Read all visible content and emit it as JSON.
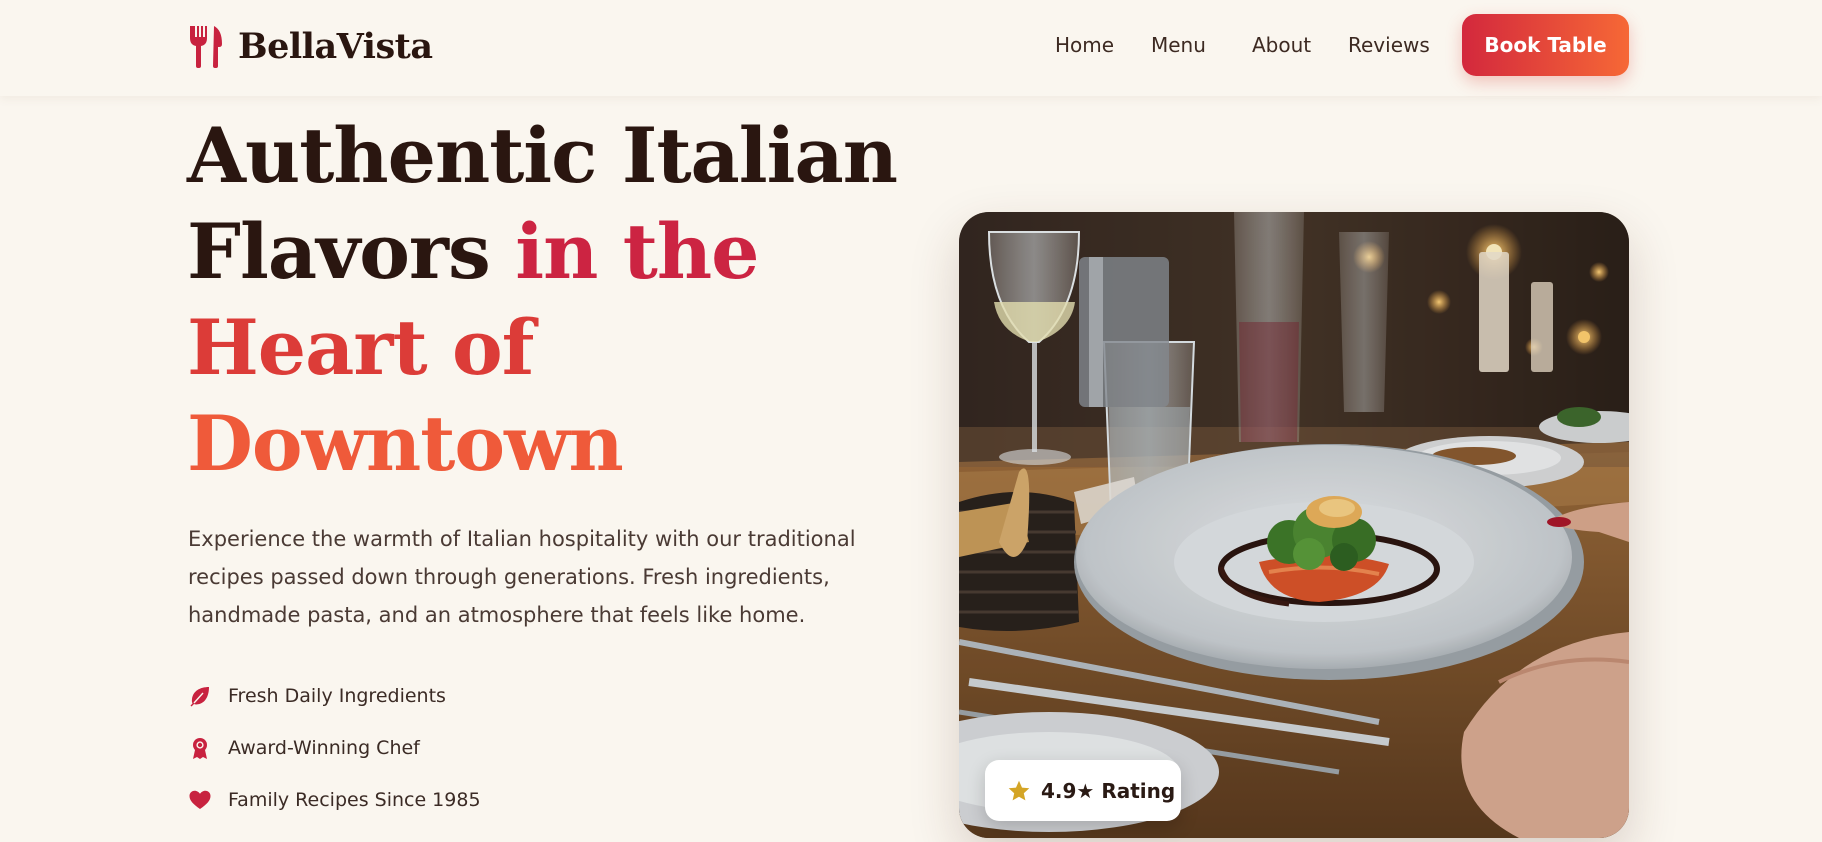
{
  "brand": {
    "name": "BellaVista",
    "icon": "fork-knife-icon",
    "color": "#c8223f"
  },
  "nav": {
    "links": [
      {
        "label": "Home"
      },
      {
        "label": "Menu"
      },
      {
        "label": "About"
      },
      {
        "label": "Reviews"
      }
    ],
    "cta_label": "Book Table"
  },
  "hero": {
    "title_line1": "Authentic Italian",
    "title_line2_plain": "Flavors ",
    "title_line2_accent": "in the",
    "title_line3": "Heart of",
    "title_line4": "Downtown",
    "description": "Experience the warmth of Italian hospitality with our traditional recipes passed down through generations. Fresh ingredients, handmade pasta, and an atmosphere that feels like home.",
    "features": [
      {
        "icon": "leaf-icon",
        "label": "Fresh Daily Ingredients"
      },
      {
        "icon": "award-icon",
        "label": "Award-Winning Chef"
      },
      {
        "icon": "heart-icon",
        "label": "Family Recipes Since 1985"
      }
    ]
  },
  "photo": {
    "rating_label": "4.9★ Rating",
    "rating_icon": "star-icon"
  },
  "colors": {
    "background": "#faf6ef",
    "text_dark": "#2a1610",
    "accent_red": "#cc2442",
    "accent_orange": "#ef5a3a",
    "star_gold": "#d4a526"
  }
}
